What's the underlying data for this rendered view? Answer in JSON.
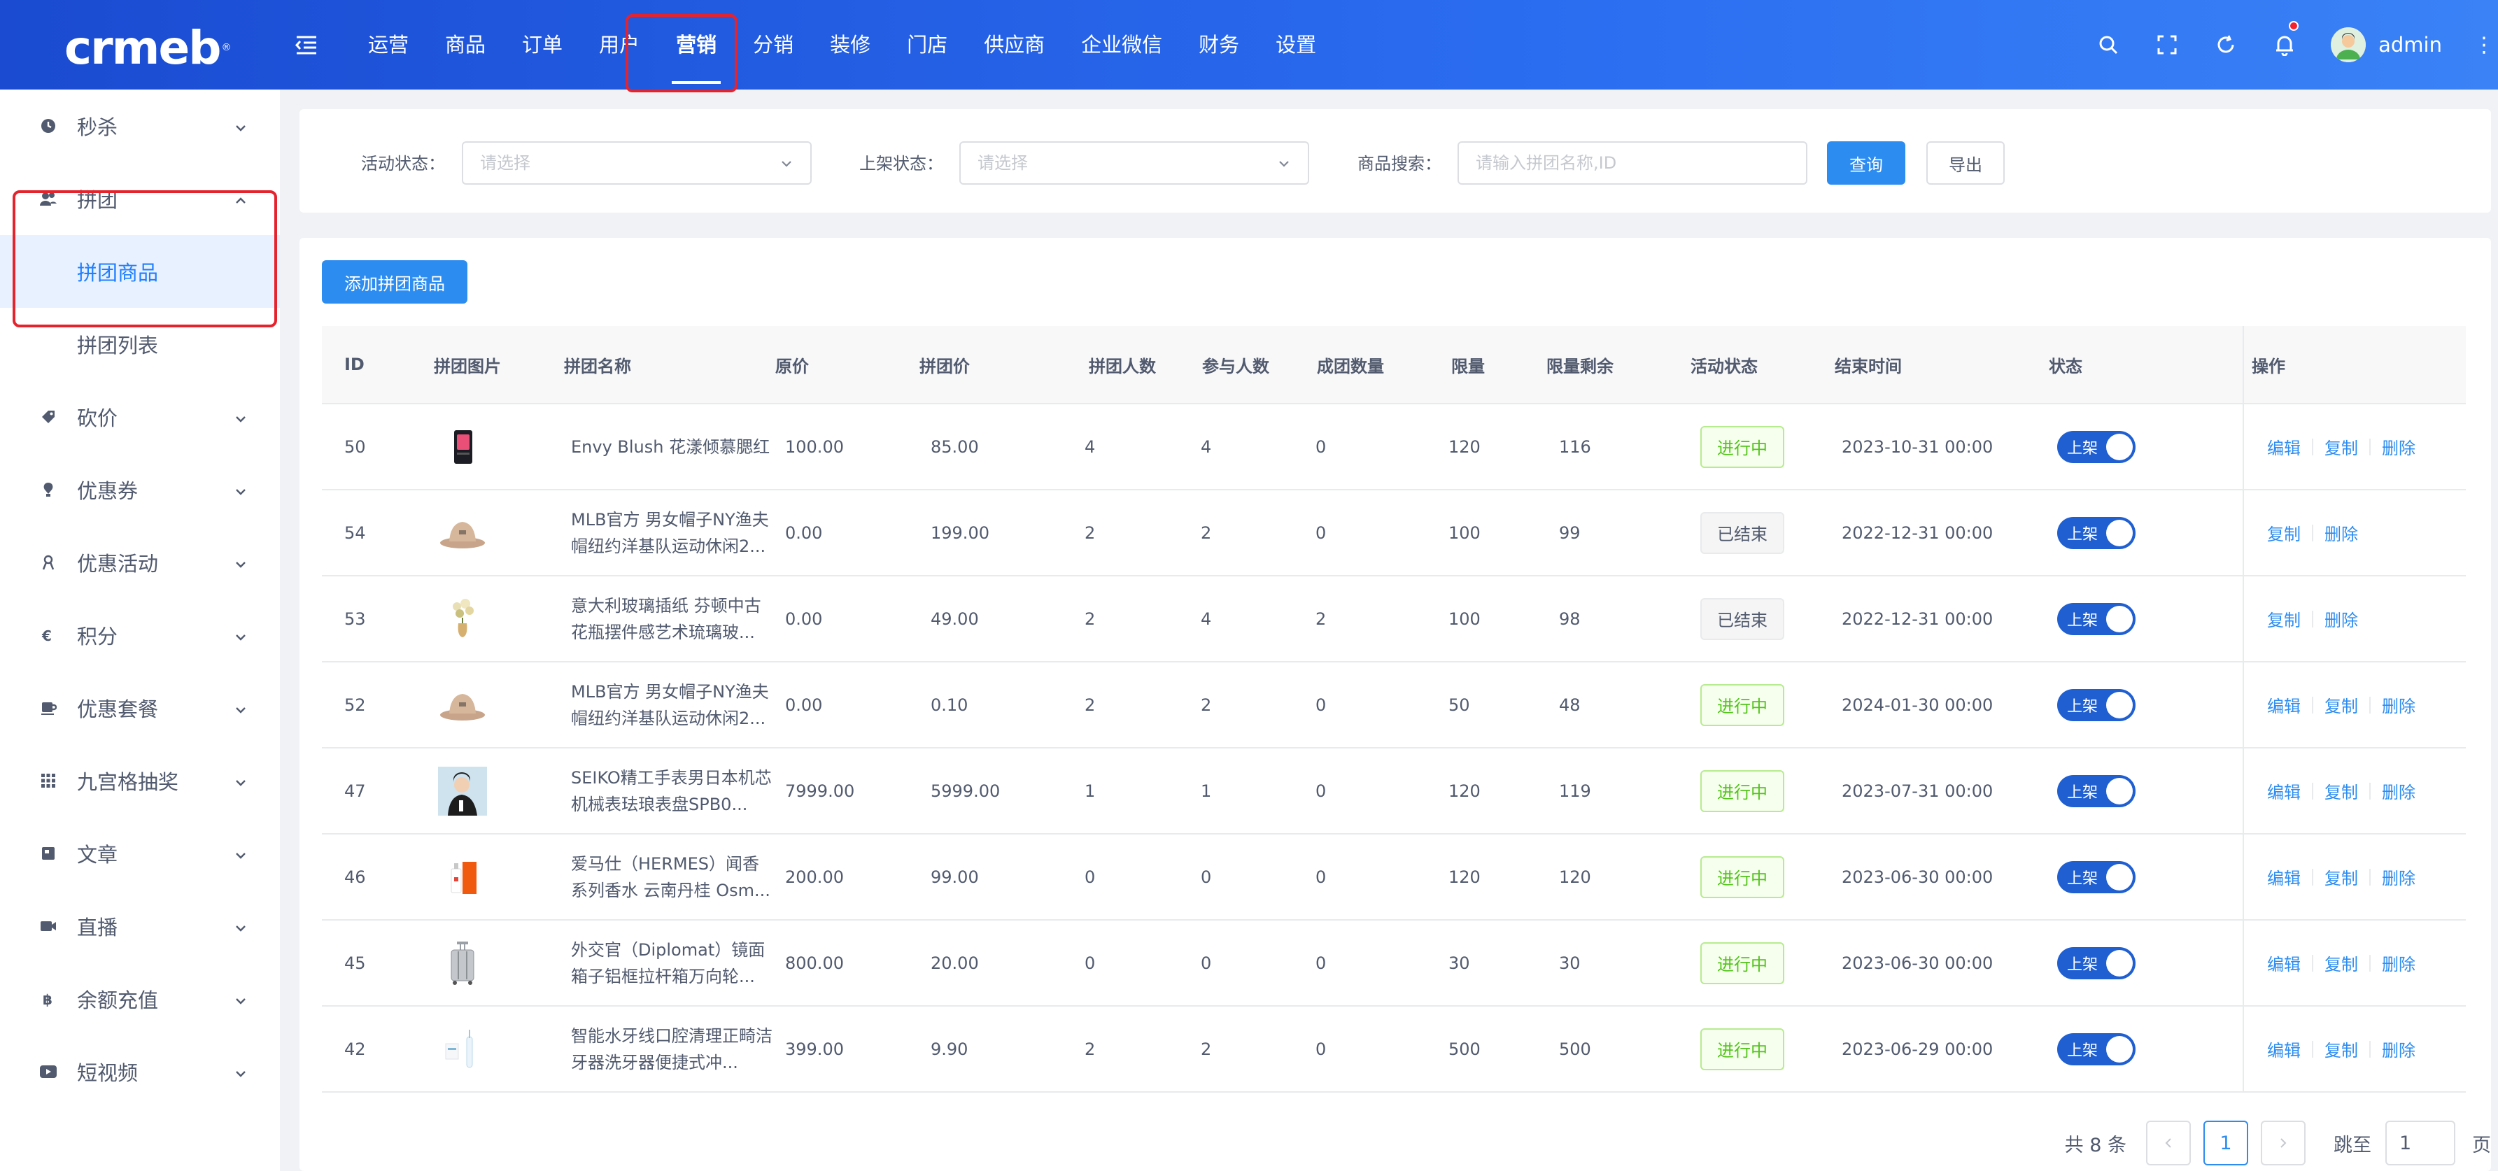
{
  "brand": {
    "logo_text": "crmeb",
    "reg": "®"
  },
  "topnav": [
    "运营",
    "商品",
    "订单",
    "用户",
    "营销",
    "分销",
    "装修",
    "门店",
    "供应商",
    "企业微信",
    "财务",
    "设置"
  ],
  "topnav_active": "营销",
  "user": {
    "name": "admin"
  },
  "sidebar": {
    "items": [
      {
        "label": "秒杀",
        "icon": "clock-icon"
      },
      {
        "label": "拼团",
        "icon": "group-icon",
        "expanded": true,
        "children": [
          {
            "label": "拼团商品",
            "active": true
          },
          {
            "label": "拼团列表"
          }
        ]
      },
      {
        "label": "砍价",
        "icon": "tag-icon"
      },
      {
        "label": "优惠券",
        "icon": "coupon-icon"
      },
      {
        "label": "优惠活动",
        "icon": "activity-icon"
      },
      {
        "label": "积分",
        "icon": "points-icon"
      },
      {
        "label": "优惠套餐",
        "icon": "package-icon"
      },
      {
        "label": "九宫格抽奖",
        "icon": "grid-icon"
      },
      {
        "label": "文章",
        "icon": "article-icon"
      },
      {
        "label": "直播",
        "icon": "video-icon"
      },
      {
        "label": "余额充值",
        "icon": "bitcoin-icon"
      },
      {
        "label": "短视频",
        "icon": "play-icon"
      }
    ]
  },
  "filters": {
    "activity_status": {
      "label": "活动状态：",
      "placeholder": "请选择"
    },
    "shelf_status": {
      "label": "上架状态：",
      "placeholder": "请选择"
    },
    "search": {
      "label": "商品搜索：",
      "placeholder": "请输入拼团名称,ID"
    },
    "query_button": "查询",
    "export_button": "导出"
  },
  "add_button": "添加拼团商品",
  "table": {
    "headers": [
      "ID",
      "拼团图片",
      "拼团名称",
      "原价",
      "拼团价",
      "拼团人数",
      "参与人数",
      "成团数量",
      "限量",
      "限量剩余",
      "活动状态",
      "结束时间",
      "状态",
      "操作"
    ],
    "rows": [
      {
        "id": "50",
        "name": "Envy Blush 花漾倾慕腮红",
        "orig": "100.00",
        "price": "85.00",
        "size": "4",
        "joined": "4",
        "groups": "0",
        "limit": "120",
        "remain": "116",
        "status": "进行中",
        "end": "2023-10-31 00:00",
        "switch": "上架",
        "ops": [
          "编辑",
          "复制",
          "删除"
        ],
        "img": "blush"
      },
      {
        "id": "54",
        "name": "MLB官方 男女帽子NY渔夫帽纽约洋基队运动休闲2...",
        "orig": "0.00",
        "price": "199.00",
        "size": "2",
        "joined": "2",
        "groups": "0",
        "limit": "100",
        "remain": "99",
        "status": "已结束",
        "end": "2022-12-31 00:00",
        "switch": "上架",
        "ops": [
          "复制",
          "删除"
        ],
        "img": "hat"
      },
      {
        "id": "53",
        "name": "意大利玻璃插纸 芬顿中古花瓶摆件感艺术琉璃玻...",
        "orig": "0.00",
        "price": "49.00",
        "size": "2",
        "joined": "4",
        "groups": "2",
        "limit": "100",
        "remain": "98",
        "status": "已结束",
        "end": "2022-12-31 00:00",
        "switch": "上架",
        "ops": [
          "复制",
          "删除"
        ],
        "img": "vase"
      },
      {
        "id": "52",
        "name": "MLB官方 男女帽子NY渔夫帽纽约洋基队运动休闲2...",
        "orig": "0.00",
        "price": "0.10",
        "size": "2",
        "joined": "2",
        "groups": "0",
        "limit": "50",
        "remain": "48",
        "status": "进行中",
        "end": "2024-01-30 00:00",
        "switch": "上架",
        "ops": [
          "编辑",
          "复制",
          "删除"
        ],
        "img": "hat"
      },
      {
        "id": "47",
        "name": "SEIKO精工手表男日本机芯机械表珐琅表盘SPB0...",
        "orig": "7999.00",
        "price": "5999.00",
        "size": "1",
        "joined": "1",
        "groups": "0",
        "limit": "120",
        "remain": "119",
        "status": "进行中",
        "end": "2023-07-31 00:00",
        "switch": "上架",
        "ops": [
          "编辑",
          "复制",
          "删除"
        ],
        "img": "person"
      },
      {
        "id": "46",
        "name": "爱马仕（HERMES）闻香系列香水 云南丹桂 Osm...",
        "orig": "200.00",
        "price": "99.00",
        "size": "0",
        "joined": "0",
        "groups": "0",
        "limit": "120",
        "remain": "120",
        "status": "进行中",
        "end": "2023-06-30 00:00",
        "switch": "上架",
        "ops": [
          "编辑",
          "复制",
          "删除"
        ],
        "img": "perfume"
      },
      {
        "id": "45",
        "name": "外交官（Diplomat）镜面箱子铝框拉杆箱万向轮...",
        "orig": "800.00",
        "price": "20.00",
        "size": "0",
        "joined": "0",
        "groups": "0",
        "limit": "30",
        "remain": "30",
        "status": "进行中",
        "end": "2023-06-30 00:00",
        "switch": "上架",
        "ops": [
          "编辑",
          "复制",
          "删除"
        ],
        "img": "luggage"
      },
      {
        "id": "42",
        "name": "智能水牙线口腔清理正畸洁牙器洗牙器便捷式冲...",
        "orig": "399.00",
        "price": "9.90",
        "size": "2",
        "joined": "2",
        "groups": "0",
        "limit": "500",
        "remain": "500",
        "status": "进行中",
        "end": "2023-06-29 00:00",
        "switch": "上架",
        "ops": [
          "编辑",
          "复制",
          "删除"
        ],
        "img": "flosser"
      }
    ]
  },
  "pagination": {
    "total_text": "共 8 条",
    "current": "1",
    "jump_label": "跳至",
    "jump_value": "1",
    "page_suffix": "页"
  }
}
